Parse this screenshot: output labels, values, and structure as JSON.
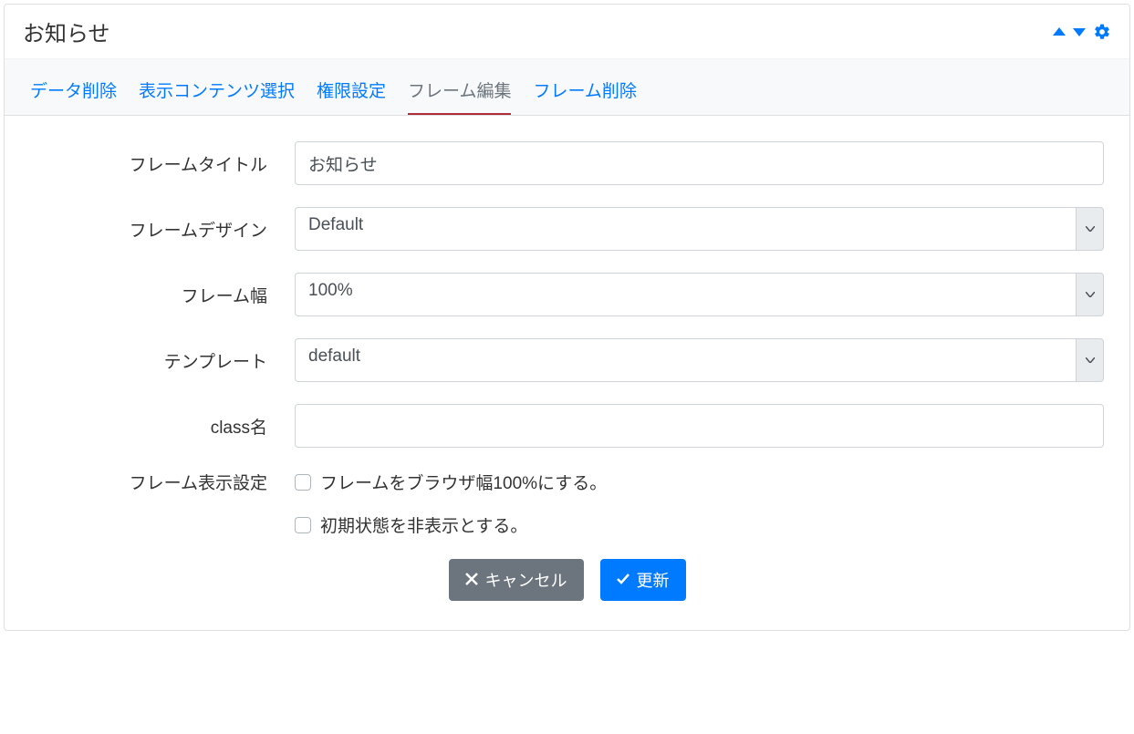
{
  "header": {
    "title": "お知らせ"
  },
  "tabs": [
    {
      "label": "データ削除",
      "active": false
    },
    {
      "label": "表示コンテンツ選択",
      "active": false
    },
    {
      "label": "権限設定",
      "active": false
    },
    {
      "label": "フレーム編集",
      "active": true
    },
    {
      "label": "フレーム削除",
      "active": false
    }
  ],
  "form": {
    "frame_title": {
      "label": "フレームタイトル",
      "value": "お知らせ"
    },
    "frame_design": {
      "label": "フレームデザイン",
      "value": "Default"
    },
    "frame_width": {
      "label": "フレーム幅",
      "value": "100%"
    },
    "template": {
      "label": "テンプレート",
      "value": "default"
    },
    "class_name": {
      "label": "class名",
      "value": ""
    },
    "display_settings": {
      "label": "フレーム表示設定",
      "checkbox1": "フレームをブラウザ幅100%にする。",
      "checkbox2": "初期状態を非表示とする。"
    }
  },
  "buttons": {
    "cancel": "キャンセル",
    "update": "更新"
  }
}
